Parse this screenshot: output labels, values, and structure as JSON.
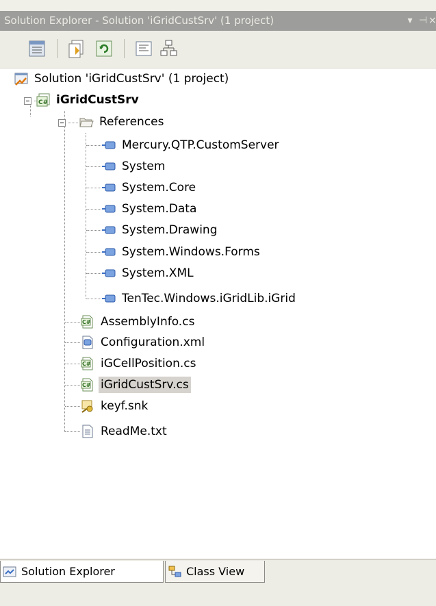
{
  "window": {
    "title": "Solution Explorer - Solution 'iGridCustSrv' (1 project)",
    "dropdown_glyph": "▾",
    "pin_glyph": "⊣",
    "close_glyph": "×"
  },
  "toolbar": {
    "buttons": [
      {
        "name": "properties-icon"
      },
      {
        "name": "show-all-files-icon"
      },
      {
        "name": "refresh-icon"
      },
      {
        "name": "view-code-icon"
      },
      {
        "name": "class-diagram-icon"
      }
    ]
  },
  "tree": {
    "solution": "Solution 'iGridCustSrv' (1 project)",
    "project": "iGridCustSrv",
    "references": {
      "label": "References",
      "items": [
        "Mercury.QTP.CustomServer",
        "System",
        "System.Core",
        "System.Data",
        "System.Drawing",
        "System.Windows.Forms",
        "System.XML",
        "TenTec.Windows.iGridLib.iGrid"
      ]
    },
    "files": [
      {
        "label": "AssemblyInfo.cs",
        "icon": "csharp-file-icon"
      },
      {
        "label": "Configuration.xml",
        "icon": "xml-file-icon"
      },
      {
        "label": "iGCellPosition.cs",
        "icon": "csharp-file-icon"
      },
      {
        "label": "iGridCustSrv.cs",
        "icon": "csharp-file-icon",
        "selected": true
      },
      {
        "label": "keyf.snk",
        "icon": "key-file-icon"
      },
      {
        "label": "ReadMe.txt",
        "icon": "text-file-icon"
      }
    ]
  },
  "tabs": {
    "solution_explorer": "Solution Explorer",
    "class_view": "Class View"
  },
  "colors": {
    "titlebar": "#9d9d9b",
    "toolbar": "#eeede5",
    "selection": "#d6d3ce"
  }
}
